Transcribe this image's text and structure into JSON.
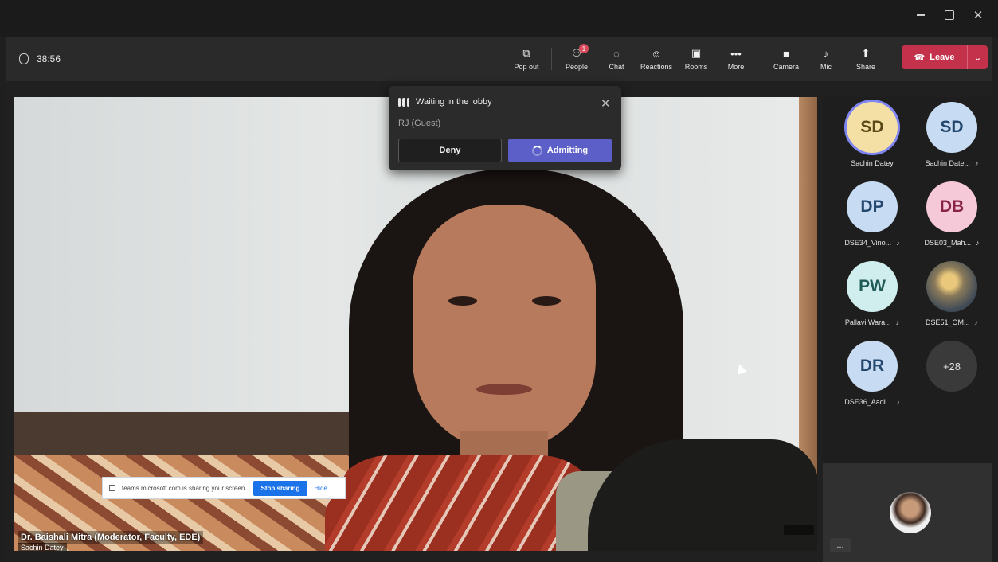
{
  "meeting": {
    "timer": "38:56"
  },
  "toolbar": {
    "items": [
      {
        "label": "Pop out",
        "icon": "pop-out-icon"
      },
      {
        "label": "People",
        "icon": "people-icon",
        "badge": "1"
      },
      {
        "label": "Chat",
        "icon": "chat-icon"
      },
      {
        "label": "Reactions",
        "icon": "reactions-icon"
      },
      {
        "label": "Rooms",
        "icon": "rooms-icon"
      },
      {
        "label": "More",
        "icon": "more-icon"
      },
      {
        "label": "Camera",
        "icon": "camera-icon"
      },
      {
        "label": "Mic",
        "icon": "mic-off-icon"
      },
      {
        "label": "Share",
        "icon": "share-icon"
      }
    ],
    "leave_label": "Leave"
  },
  "lobby": {
    "title": "Waiting in the lobby",
    "guest": "RJ (Guest)",
    "deny_label": "Deny",
    "admit_label": "Admitting"
  },
  "screen_share_bar": {
    "message": "teams.microsoft.com is sharing your screen.",
    "stop_label": "Stop sharing",
    "hide_label": "Hide"
  },
  "video": {
    "speaker_name": "Dr. Baishali Mitra (Moderator, Faculty, EDE)",
    "sub_label": "Sachin Datey"
  },
  "participants": [
    {
      "initials": "SD",
      "name": "Sachin Datey",
      "bg": "#f4dfa4",
      "fg": "#5a4a1a",
      "muted": false,
      "active": true
    },
    {
      "initials": "SD",
      "name": "Sachin Date...",
      "bg": "#c7dcf2",
      "fg": "#24476e",
      "muted": true,
      "active": false
    },
    {
      "initials": "DP",
      "name": "DSE34_Vino...",
      "bg": "#c7dcf2",
      "fg": "#24476e",
      "muted": true,
      "active": false
    },
    {
      "initials": "DB",
      "name": "DSE03_Mah...",
      "bg": "#f6c9d8",
      "fg": "#8a2447",
      "muted": true,
      "active": false
    },
    {
      "initials": "PW",
      "name": "Pallavi Wara...",
      "bg": "#cfeeed",
      "fg": "#1f5a57",
      "muted": true,
      "active": false
    },
    {
      "initials": "",
      "name": "DSE51_OM...",
      "bg": "",
      "fg": "",
      "muted": true,
      "active": false,
      "photo": true
    },
    {
      "initials": "DR",
      "name": "DSE36_Aadi...",
      "bg": "#c7dcf2",
      "fg": "#24476e",
      "muted": true,
      "active": false
    },
    {
      "initials": "+28",
      "name": "",
      "bg": "#3a3a3a",
      "fg": "#e0e0e0",
      "muted": false,
      "active": false,
      "more": true
    }
  ],
  "self_view": {
    "more_label": "..."
  },
  "colors": {
    "leave": "#c4314b",
    "admit": "#5b5fc7",
    "badge": "#d74b5a"
  }
}
